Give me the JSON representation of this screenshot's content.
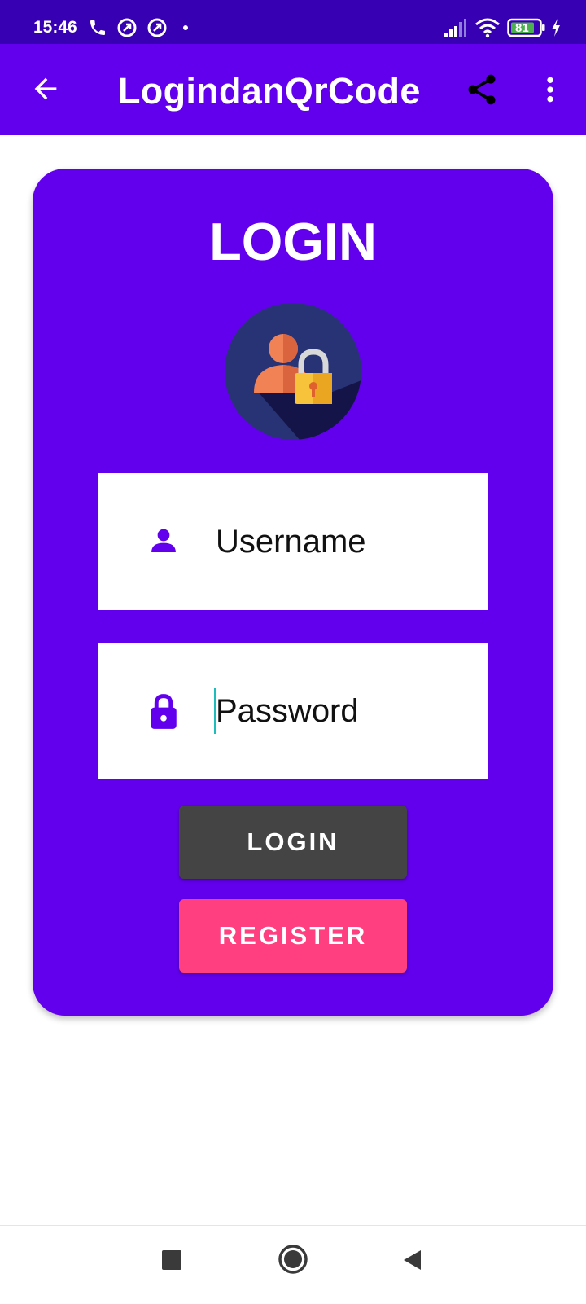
{
  "status_bar": {
    "time": "15:46",
    "battery_level": "81",
    "icons": [
      "phone-icon",
      "app-notification-icon",
      "app-notification-icon",
      "dot-icon",
      "signal-icon",
      "wifi-icon",
      "battery-icon",
      "charging-icon"
    ]
  },
  "app_bar": {
    "title": "LogindanQrCode",
    "icons": [
      "back-arrow-icon",
      "share-icon",
      "more-vert-icon"
    ]
  },
  "login_card": {
    "title": "LOGIN",
    "username": {
      "placeholder": "Username",
      "value": "",
      "icon": "person-icon"
    },
    "password": {
      "placeholder": "Password",
      "value": "",
      "icon": "lock-icon"
    },
    "login_button": "LOGIN",
    "register_button": "REGISTER"
  },
  "nav_bar": {
    "icons": [
      "recents-square-icon",
      "home-circle-icon",
      "back-triangle-icon"
    ]
  },
  "colors": {
    "status_bar": "#3700b3",
    "primary": "#6200ee",
    "login_button": "#444444",
    "register_button": "#ff3f80",
    "caret": "#1fbcbc"
  }
}
